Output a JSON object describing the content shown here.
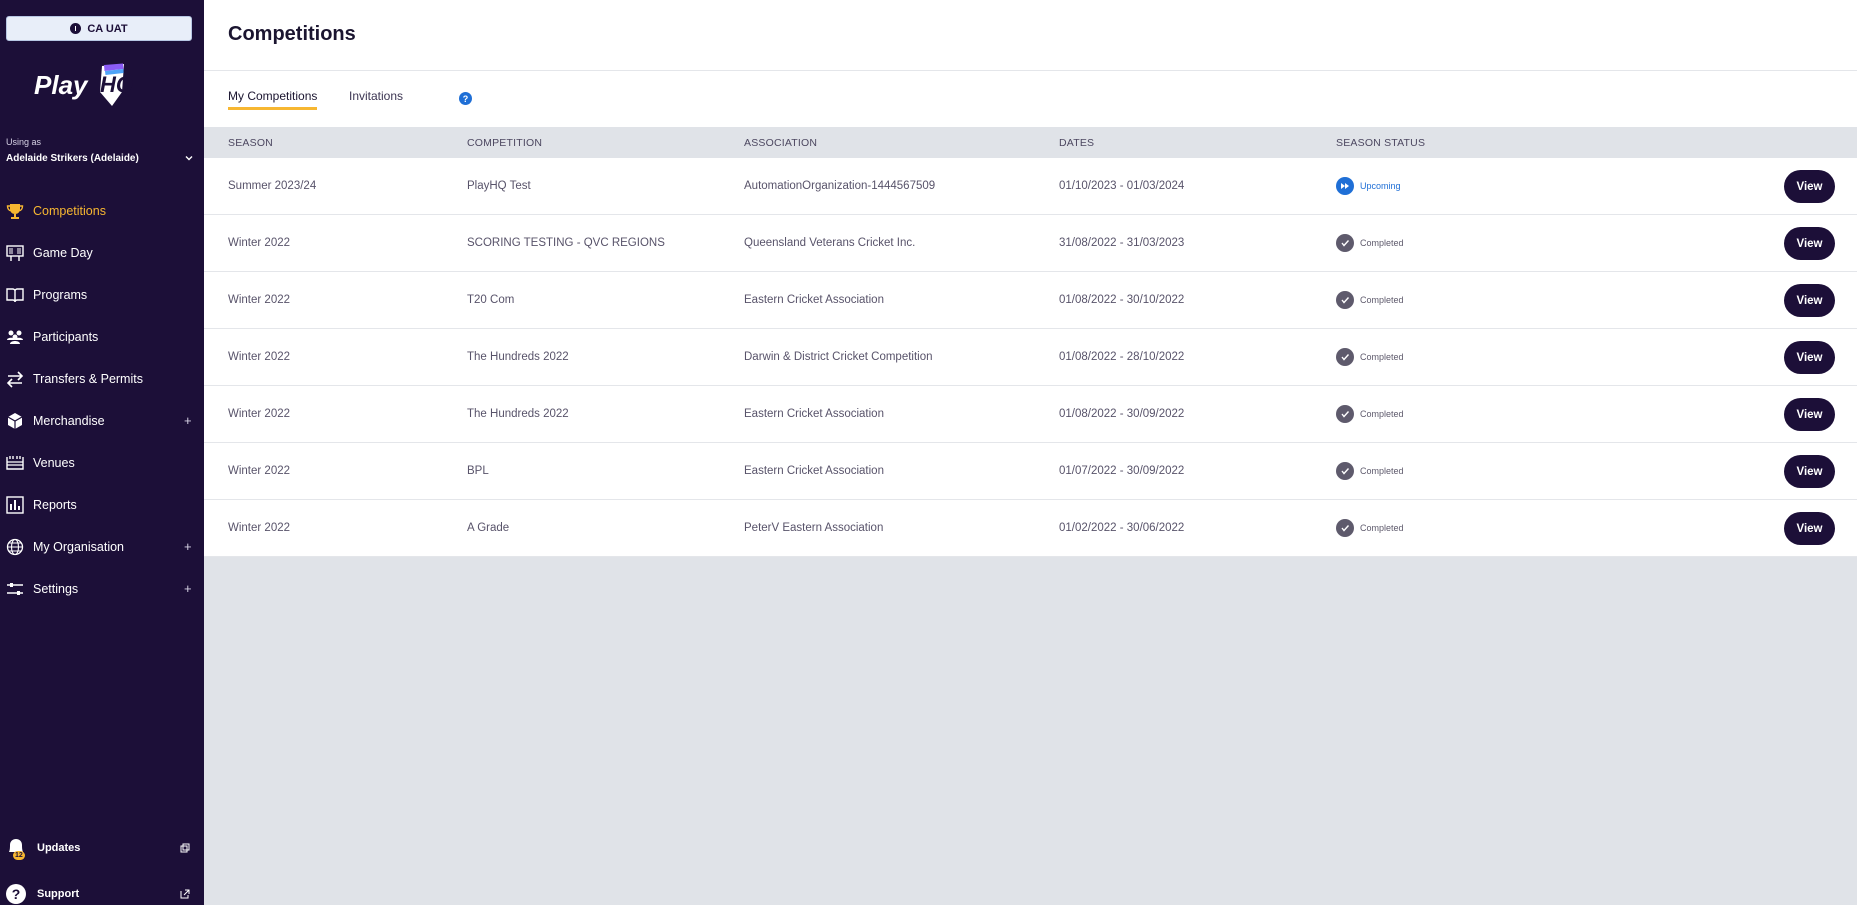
{
  "env_badge": "CA UAT",
  "brand": {
    "logo_text": "PlayHQ"
  },
  "account": {
    "using_as_label": "Using as",
    "org_name": "Adelaide Strikers (Adelaide)"
  },
  "sidebar": {
    "items": [
      {
        "label": "Competitions",
        "icon": "trophy-icon",
        "active": true,
        "expandable": false
      },
      {
        "label": "Game Day",
        "icon": "scoreboard-icon",
        "active": false,
        "expandable": false
      },
      {
        "label": "Programs",
        "icon": "book-icon",
        "active": false,
        "expandable": false
      },
      {
        "label": "Participants",
        "icon": "people-icon",
        "active": false,
        "expandable": false
      },
      {
        "label": "Transfers & Permits",
        "icon": "transfer-arrows-icon",
        "active": false,
        "expandable": false
      },
      {
        "label": "Merchandise",
        "icon": "box-icon",
        "active": false,
        "expandable": true
      },
      {
        "label": "Venues",
        "icon": "stadium-icon",
        "active": false,
        "expandable": false
      },
      {
        "label": "Reports",
        "icon": "bar-chart-icon",
        "active": false,
        "expandable": false
      },
      {
        "label": "My Organisation",
        "icon": "globe-icon",
        "active": false,
        "expandable": true
      },
      {
        "label": "Settings",
        "icon": "sliders-icon",
        "active": false,
        "expandable": true
      }
    ],
    "expand_symbol": "+",
    "updates": {
      "label": "Updates",
      "badge": "12"
    },
    "support": {
      "label": "Support"
    }
  },
  "header": {
    "title": "Competitions"
  },
  "tabs": [
    {
      "label": "My Competitions",
      "active": true
    },
    {
      "label": "Invitations",
      "active": false
    }
  ],
  "help_symbol": "?",
  "table": {
    "columns": [
      "SEASON",
      "COMPETITION",
      "ASSOCIATION",
      "DATES",
      "SEASON STATUS"
    ],
    "view_label": "View",
    "rows": [
      {
        "season": "Summer 2023/24",
        "competition": "PlayHQ Test",
        "association": "AutomationOrganization-1444567509",
        "dates": "01/10/2023 - 01/03/2024",
        "status": "Upcoming"
      },
      {
        "season": "Winter 2022",
        "competition": "SCORING TESTING - QVC REGIONS",
        "association": "Queensland Veterans Cricket Inc.",
        "dates": "31/08/2022 - 31/03/2023",
        "status": "Completed"
      },
      {
        "season": "Winter 2022",
        "competition": "T20 Com",
        "association": "Eastern Cricket Association",
        "dates": "01/08/2022 - 30/10/2022",
        "status": "Completed"
      },
      {
        "season": "Winter 2022",
        "competition": "The Hundreds 2022",
        "association": "Darwin & District Cricket Competition",
        "dates": "01/08/2022 - 28/10/2022",
        "status": "Completed"
      },
      {
        "season": "Winter 2022",
        "competition": "The Hundreds 2022",
        "association": "Eastern Cricket Association",
        "dates": "01/08/2022 - 30/09/2022",
        "status": "Completed"
      },
      {
        "season": "Winter 2022",
        "competition": "BPL",
        "association": "Eastern Cricket Association",
        "dates": "01/07/2022 - 30/09/2022",
        "status": "Completed"
      },
      {
        "season": "Winter 2022",
        "competition": "A Grade",
        "association": "PeterV Eastern Association",
        "dates": "01/02/2022 - 30/06/2022",
        "status": "Completed"
      }
    ]
  },
  "colors": {
    "sidebar_bg": "#1c0f38",
    "accent": "#f7b731",
    "upcoming": "#1f6fd6",
    "completed": "#5e5a6c"
  }
}
